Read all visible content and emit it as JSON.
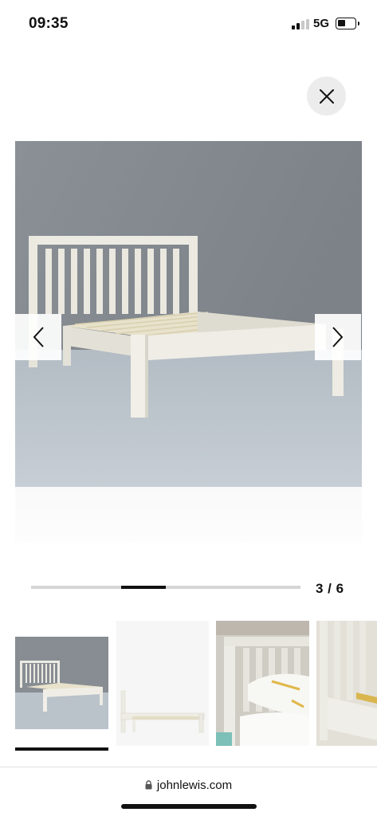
{
  "status_bar": {
    "time": "09:35",
    "network": "5G",
    "signal_icon": "cellular-signal-icon",
    "battery_icon": "battery-icon",
    "battery_level": 0.35
  },
  "gallery": {
    "close_icon": "close-icon",
    "prev_icon": "chevron-left-icon",
    "next_icon": "chevron-right-icon",
    "main_image": "white wooden slatted bed frame",
    "current": 3,
    "total": 6,
    "counter_text": "3 / 6",
    "progress_fraction_start": 0.333,
    "progress_fraction_end": 0.5,
    "thumbnails": [
      {
        "subject": "bed frame front view",
        "selected": true
      },
      {
        "subject": "bed frame side view",
        "selected": false
      },
      {
        "subject": "headboard close-up with bedding",
        "selected": false
      },
      {
        "subject": "headboard slats detail",
        "selected": false
      }
    ]
  },
  "browser": {
    "url": "johnlewis.com",
    "lock_icon": "lock-icon"
  },
  "colors": {
    "accent": "#111111",
    "track": "#d6d6d6",
    "close_bg": "#ececec"
  }
}
